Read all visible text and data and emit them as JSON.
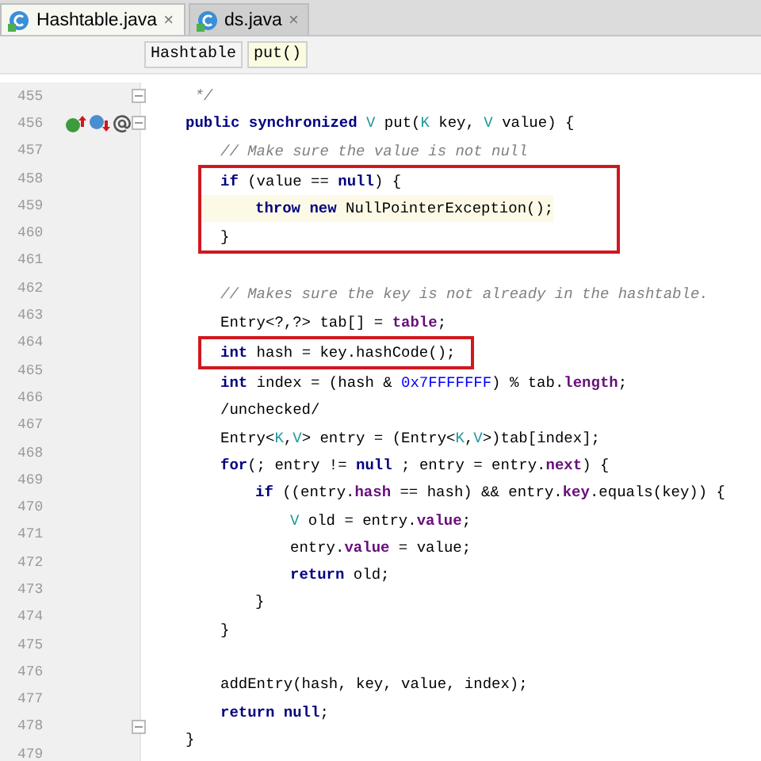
{
  "tabs": [
    {
      "label": "Hashtable.java",
      "close": "×",
      "selected": true
    },
    {
      "label": "ds.java",
      "close": "×",
      "selected": false
    }
  ],
  "breadcrumbs": [
    {
      "label": "Hashtable",
      "selected": false
    },
    {
      "label": "put()",
      "selected": true
    }
  ],
  "lines": [
    {
      "kind": "line",
      "number": "455",
      "current": false,
      "gutter_icons": [
        {
          "kind": "fold"
        }
      ],
      "tokens": [
        {
          "t": " */",
          "kind": "comment"
        }
      ]
    },
    {
      "kind": "line",
      "number": "456",
      "current": false,
      "gutter_icons": [
        {
          "kind": "implements"
        },
        {
          "kind": "overrides"
        },
        {
          "kind": "annotation"
        },
        {
          "kind": "fold"
        }
      ],
      "tokens": [
        {
          "t": "public synchronized ",
          "kind": "kw"
        },
        {
          "t": "V",
          "kind": "type"
        },
        {
          "t": " put(",
          "kind": "plain"
        },
        {
          "t": "K",
          "kind": "type"
        },
        {
          "t": " key, ",
          "kind": "plain"
        },
        {
          "t": "V",
          "kind": "type"
        },
        {
          "t": " value) {",
          "kind": "plain"
        }
      ],
      "children": [
        {
          "kind": "line",
          "number": "457",
          "current": false,
          "tokens": [
            {
              "t": "// Make sure the value is not null",
              "kind": "comment"
            }
          ]
        },
        {
          "kind": "box",
          "children": [
            {
              "kind": "line",
              "number": "458",
              "current": false,
              "tokens": [
                {
                  "t": "if",
                  "kind": "kw"
                },
                {
                  "t": " (value == ",
                  "kind": "plain"
                },
                {
                  "t": "null",
                  "kind": "kw"
                },
                {
                  "t": ") {",
                  "kind": "plain"
                }
              ],
              "children": [
                {
                  "kind": "line",
                  "number": "459",
                  "current": true,
                  "tokens": [
                    {
                      "t": "throw new",
                      "kind": "kw"
                    },
                    {
                      "t": " NullPointerException();",
                      "kind": "plain"
                    }
                  ]
                }
              ]
            },
            {
              "kind": "line",
              "number": "460",
              "current": false,
              "tokens": [
                {
                  "t": "}",
                  "kind": "plain"
                }
              ]
            }
          ]
        },
        {
          "kind": "line",
          "number": "461",
          "current": false
        },
        {
          "kind": "line",
          "number": "462",
          "current": false,
          "tokens": [
            {
              "t": "// Makes sure the key is not already in the hashtable.",
              "kind": "comment"
            }
          ]
        },
        {
          "kind": "line",
          "number": "463",
          "current": false,
          "tokens": [
            {
              "t": "Entry<?,?> tab[] = ",
              "kind": "plain"
            },
            {
              "t": "table",
              "kind": "field"
            },
            {
              "t": ";",
              "kind": "plain"
            }
          ]
        },
        {
          "kind": "box",
          "children": [
            {
              "kind": "line",
              "number": "464",
              "current": false,
              "tokens": [
                {
                  "t": "int",
                  "kind": "kw"
                },
                {
                  "t": " hash = key.hashCode();",
                  "kind": "plain"
                }
              ]
            }
          ]
        },
        {
          "kind": "line",
          "number": "465",
          "current": false,
          "tokens": [
            {
              "t": "int",
              "kind": "kw"
            },
            {
              "t": " index = (hash & ",
              "kind": "plain"
            },
            {
              "t": "0x7FFFFFFF",
              "kind": "number"
            },
            {
              "t": ") % tab.",
              "kind": "plain"
            },
            {
              "t": "length",
              "kind": "field"
            },
            {
              "t": ";",
              "kind": "plain"
            }
          ]
        },
        {
          "kind": "line",
          "number": "466",
          "current": false,
          "tokens": [
            {
              "t": "/unchecked/",
              "kind": "plain"
            }
          ]
        },
        {
          "kind": "line",
          "number": "467",
          "current": false,
          "tokens": [
            {
              "t": "Entry<",
              "kind": "plain"
            },
            {
              "t": "K",
              "kind": "type"
            },
            {
              "t": ",",
              "kind": "plain"
            },
            {
              "t": "V",
              "kind": "type"
            },
            {
              "t": "> entry = (Entry<",
              "kind": "plain"
            },
            {
              "t": "K",
              "kind": "type"
            },
            {
              "t": ",",
              "kind": "plain"
            },
            {
              "t": "V",
              "kind": "type"
            },
            {
              "t": ">)tab[index];",
              "kind": "plain"
            }
          ]
        },
        {
          "kind": "line",
          "number": "468",
          "current": false,
          "tokens": [
            {
              "t": "for",
              "kind": "kw"
            },
            {
              "t": "(; entry != ",
              "kind": "plain"
            },
            {
              "t": "null",
              "kind": "kw"
            },
            {
              "t": " ; entry = entry.",
              "kind": "plain"
            },
            {
              "t": "next",
              "kind": "field"
            },
            {
              "t": ") {",
              "kind": "plain"
            }
          ],
          "children": [
            {
              "kind": "line",
              "number": "469",
              "current": false,
              "tokens": [
                {
                  "t": "if",
                  "kind": "kw"
                },
                {
                  "t": " ((entry.",
                  "kind": "plain"
                },
                {
                  "t": "hash",
                  "kind": "field"
                },
                {
                  "t": " == hash) && entry.",
                  "kind": "plain"
                },
                {
                  "t": "key",
                  "kind": "field"
                },
                {
                  "t": ".equals(key)) {",
                  "kind": "plain"
                }
              ],
              "children": [
                {
                  "kind": "line",
                  "number": "470",
                  "current": false,
                  "tokens": [
                    {
                      "t": "V",
                      "kind": "type"
                    },
                    {
                      "t": " old = entry.",
                      "kind": "plain"
                    },
                    {
                      "t": "value",
                      "kind": "field"
                    },
                    {
                      "t": ";",
                      "kind": "plain"
                    }
                  ]
                },
                {
                  "kind": "line",
                  "number": "471",
                  "current": false,
                  "tokens": [
                    {
                      "t": "entry.",
                      "kind": "plain"
                    },
                    {
                      "t": "value",
                      "kind": "field"
                    },
                    {
                      "t": " = value;",
                      "kind": "plain"
                    }
                  ]
                },
                {
                  "kind": "line",
                  "number": "472",
                  "current": false,
                  "tokens": [
                    {
                      "t": "return",
                      "kind": "kw"
                    },
                    {
                      "t": " old;",
                      "kind": "plain"
                    }
                  ]
                }
              ]
            },
            {
              "kind": "line",
              "number": "473",
              "current": false,
              "tokens": [
                {
                  "t": "}",
                  "kind": "plain"
                }
              ]
            }
          ]
        },
        {
          "kind": "line",
          "number": "474",
          "current": false,
          "tokens": [
            {
              "t": "}",
              "kind": "plain"
            }
          ]
        },
        {
          "kind": "line",
          "number": "475",
          "current": false
        },
        {
          "kind": "line",
          "number": "476",
          "current": false,
          "tokens": [
            {
              "t": "addEntry(hash, key, value, index);",
              "kind": "plain"
            }
          ]
        },
        {
          "kind": "line",
          "number": "477",
          "current": false,
          "tokens": [
            {
              "t": "return null",
              "kind": "kw"
            },
            {
              "t": ";",
              "kind": "plain"
            }
          ]
        }
      ]
    },
    {
      "kind": "line",
      "number": "478",
      "current": false,
      "gutter_icons": [
        {
          "kind": "fold"
        }
      ],
      "tokens": [
        {
          "t": "}",
          "kind": "plain"
        }
      ]
    },
    {
      "kind": "line",
      "number": "479",
      "current": false
    }
  ]
}
